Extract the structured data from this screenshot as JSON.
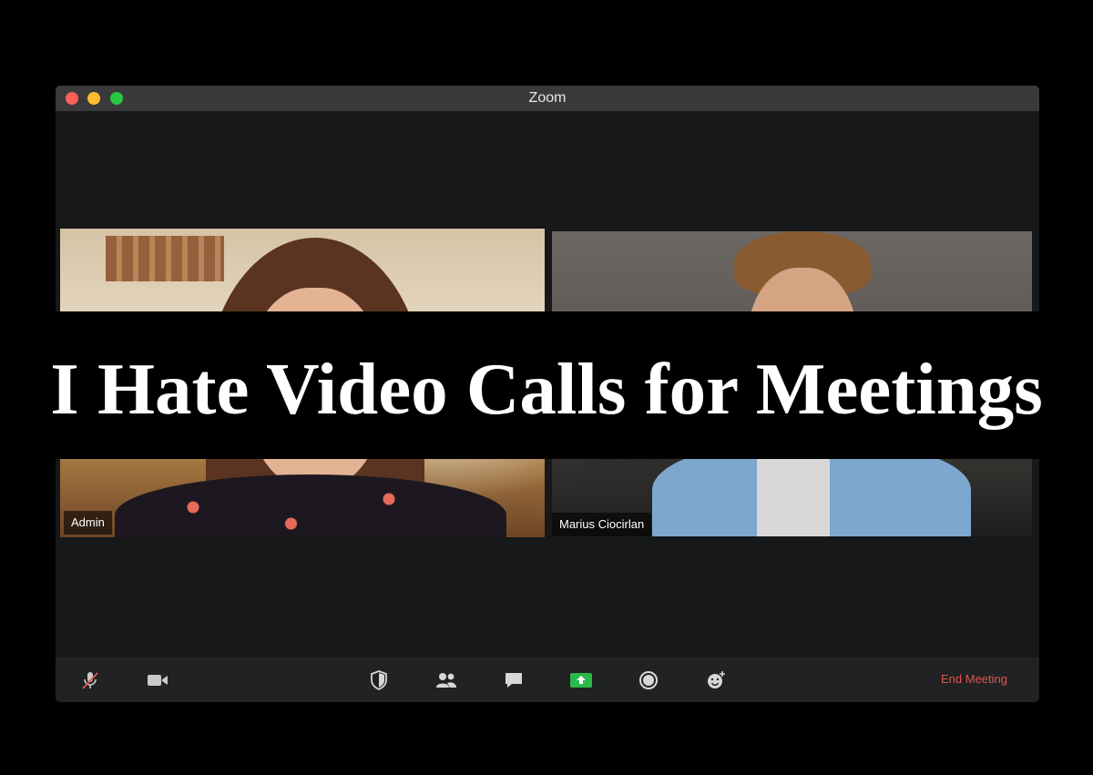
{
  "window": {
    "title": "Zoom",
    "traffic_lights": [
      "close",
      "minimize",
      "maximize"
    ]
  },
  "participants": [
    {
      "name": "Admin",
      "active_speaker": true
    },
    {
      "name": "Marius Ciocirlan",
      "active_speaker": false
    }
  ],
  "toolbar": {
    "icons": [
      "microphone-muted-icon",
      "video-camera-icon",
      "security-shield-icon",
      "participants-icon",
      "chat-icon",
      "share-screen-icon",
      "record-icon",
      "reactions-icon"
    ],
    "end_meeting_label": "End Meeting"
  },
  "overlay": {
    "headline": "I Hate Video Calls for Meetings"
  },
  "colors": {
    "active_speaker_border": "#b6d94c",
    "share_button": "#2bb84a",
    "end_meeting": "#e2564d"
  }
}
